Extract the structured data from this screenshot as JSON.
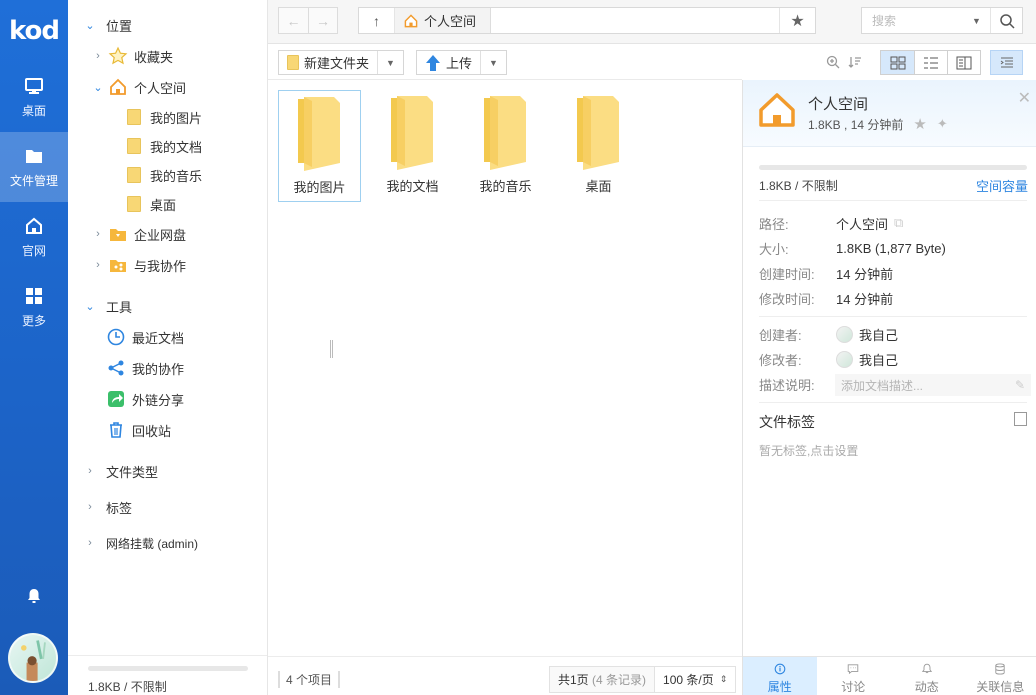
{
  "app": {
    "logo": "kod"
  },
  "appbar": {
    "items": [
      {
        "label": "桌面",
        "icon": "monitor-icon"
      },
      {
        "label": "文件管理",
        "icon": "folder-icon",
        "active": true
      },
      {
        "label": "官网",
        "icon": "home-icon"
      },
      {
        "label": "更多",
        "icon": "grid-icon"
      }
    ]
  },
  "sidebar": {
    "location": "位置",
    "favorites": "收藏夹",
    "personal": "个人空间",
    "sub": [
      "我的图片",
      "我的文档",
      "我的音乐",
      "桌面"
    ],
    "enterprise": "企业网盘",
    "shared": "与我协作",
    "tools": "工具",
    "tool_items": [
      "最近文档",
      "我的协作",
      "外链分享",
      "回收站"
    ],
    "filetypes": "文件类型",
    "tags": "标签",
    "network": "网络挂载 (admin)",
    "quota": "1.8KB / 不限制"
  },
  "addressbar": {
    "crumb": "个人空间",
    "search_placeholder": "搜索"
  },
  "toolbar": {
    "new_folder": "新建文件夹",
    "upload": "上传"
  },
  "files": [
    "我的图片",
    "我的文档",
    "我的音乐",
    "桌面"
  ],
  "status": {
    "count": "4 个项目",
    "page": "共1页",
    "records": "(4 条记录)",
    "per_page": "100 条/页"
  },
  "panel": {
    "title": "个人空间",
    "subtitle": "1.8KB , 14 分钟前",
    "quota": "1.8KB / 不限制",
    "quota_link": "空间容量",
    "rows": [
      {
        "k": "路径:",
        "v": "个人空间"
      },
      {
        "k": "大小:",
        "v": "1.8KB (1,877 Byte)"
      },
      {
        "k": "创建时间:",
        "v": "14 分钟前"
      },
      {
        "k": "修改时间:",
        "v": "14 分钟前"
      }
    ],
    "creator_label": "创建者:",
    "creator": "我自己",
    "modifier_label": "修改者:",
    "modifier": "我自己",
    "desc_label": "描述说明:",
    "desc_placeholder": "添加文档描述...",
    "tags_title": "文件标签",
    "tags_empty": "暂无标签,点击设置",
    "tabs": [
      "属性",
      "讨论",
      "动态",
      "关联信息"
    ]
  },
  "colors": {
    "accent": "#2f86e0",
    "appbar": "#1f6fd8",
    "folder": "#f8d775"
  }
}
